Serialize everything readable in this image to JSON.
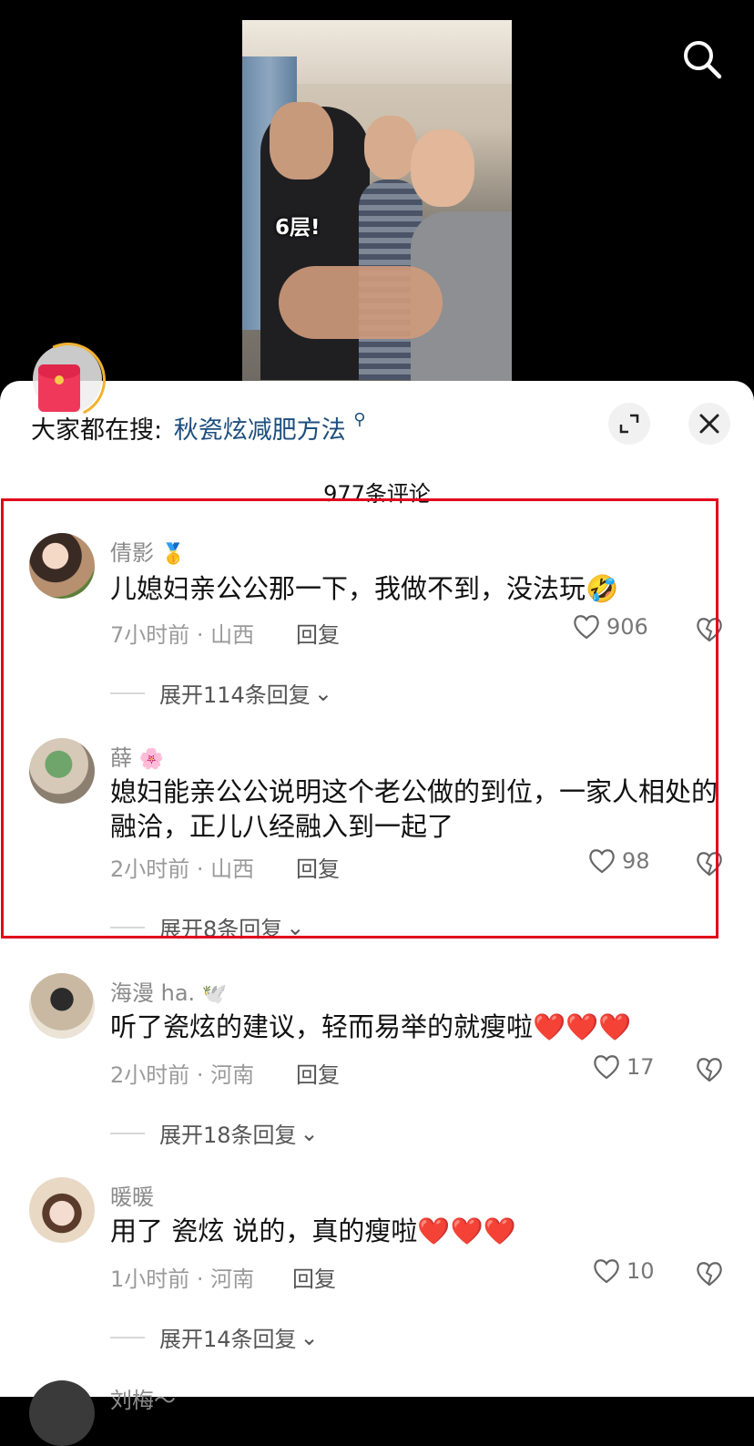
{
  "video": {
    "caption": "6层!"
  },
  "icons": {
    "search": "search-icon",
    "redpacket": "red-packet-icon",
    "expand": "expand-icon",
    "close": "close-icon"
  },
  "hot_search": {
    "label": "大家都在搜:",
    "query": "秋瓷炫减肥方法"
  },
  "comment_count": "977条评论",
  "comments": [
    {
      "user": "倩影",
      "badge": "🥇",
      "text": "儿媳妇亲公公那一下，我做不到，没法玩🤣",
      "meta": "7小时前 · 山西",
      "reply": "回复",
      "likes": "906",
      "expand": "展开114条回复"
    },
    {
      "user": "薛",
      "badge": "🌸",
      "text": "媳妇能亲公公说明这个老公做的到位，一家人相处的融洽，正儿八经融入到一起了",
      "meta": "2小时前 · 山西",
      "reply": "回复",
      "likes": "98",
      "expand": "展开8条回复"
    },
    {
      "user": "海漫 ha.",
      "badge": "🕊️",
      "text": "听了瓷炫的建议，轻而易举的就瘦啦❤️❤️❤️",
      "meta": "2小时前 · 河南",
      "reply": "回复",
      "likes": "17",
      "expand": "展开18条回复"
    },
    {
      "user": "暖暖",
      "badge": "",
      "text": "用了 瓷炫 说的，真的瘦啦❤️❤️❤️",
      "meta": "1小时前 · 河南",
      "reply": "回复",
      "likes": "10",
      "expand": "展开14条回复"
    },
    {
      "user": "刘梅～",
      "badge": "",
      "text": "",
      "meta": "",
      "reply": "",
      "likes": "",
      "expand": ""
    }
  ],
  "colors": {
    "highlight": "#e0001b",
    "link": "#1d4e7e"
  }
}
